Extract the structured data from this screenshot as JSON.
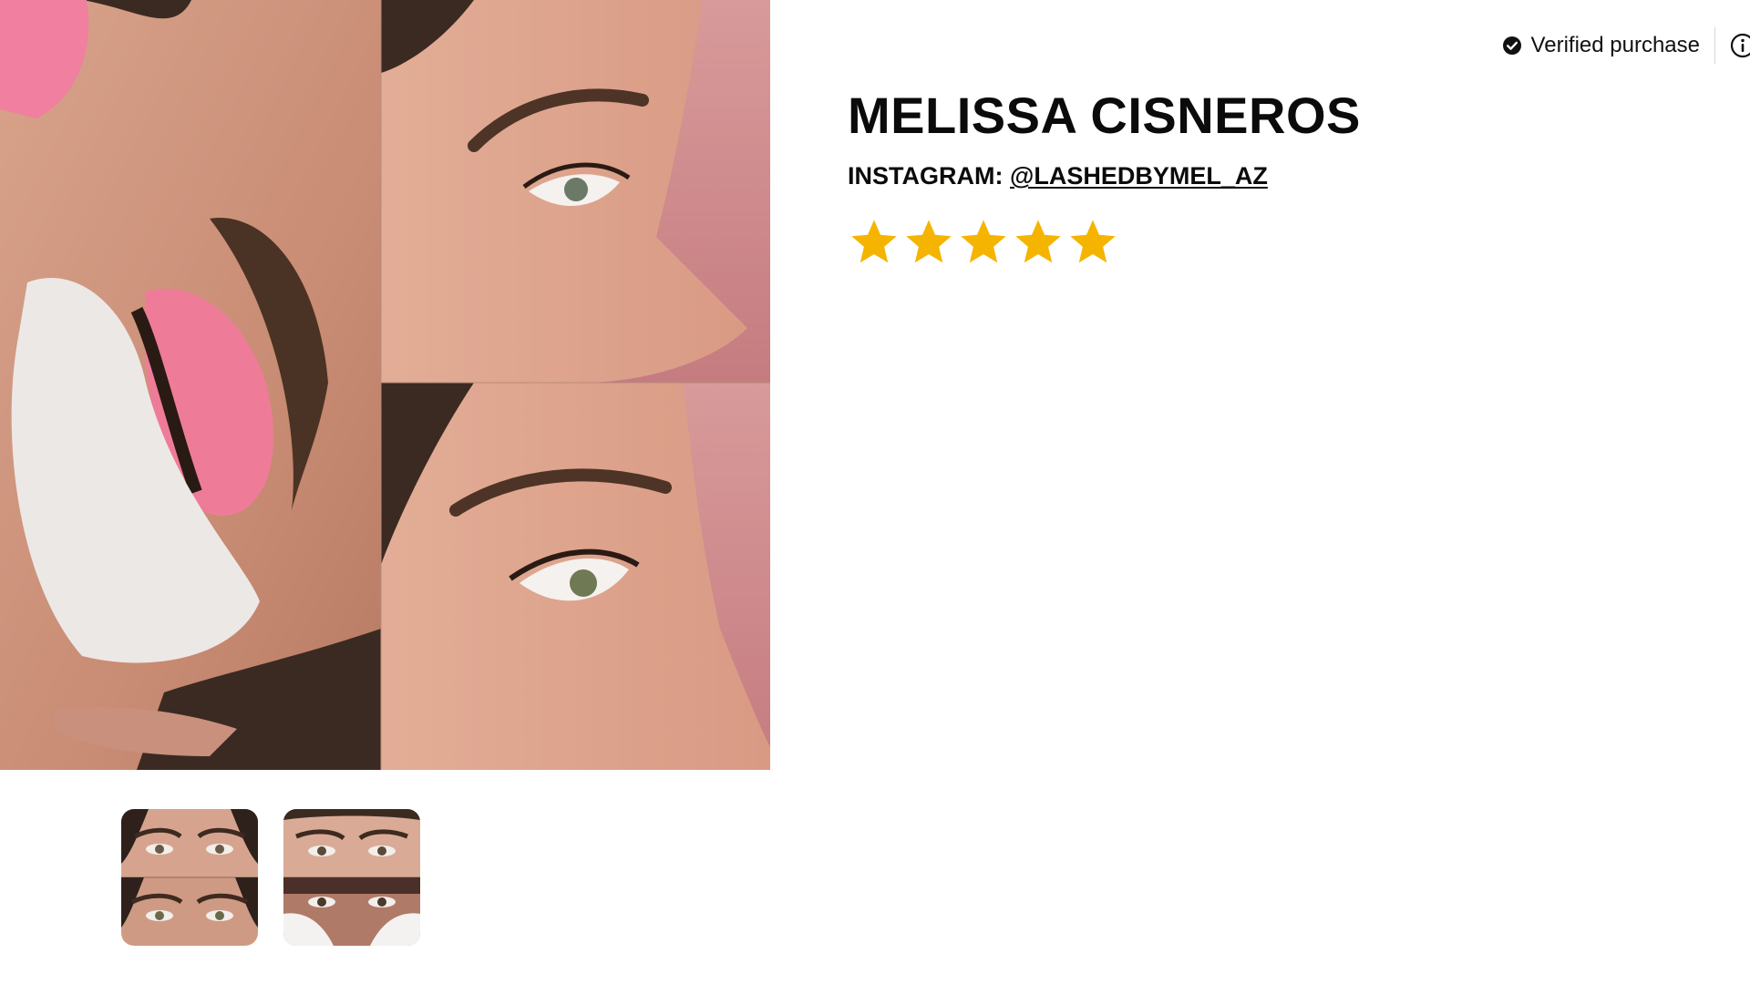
{
  "verified": {
    "label": "Verified purchase",
    "check_color": "#111111"
  },
  "reviewer": {
    "name": "MELISSA CISNEROS",
    "instagram_prefix": "INSTAGRAM:",
    "instagram_handle": "@LASHEDBYMEL_AZ"
  },
  "rating": {
    "value": 5,
    "max": 5,
    "color": "#F5B400"
  },
  "thumbnails": [
    {
      "alt": "before and after eyes photo 1"
    },
    {
      "alt": "before and after eyes photo 2"
    }
  ],
  "icons": [
    "check-circle-icon",
    "info-icon",
    "star-icon"
  ]
}
